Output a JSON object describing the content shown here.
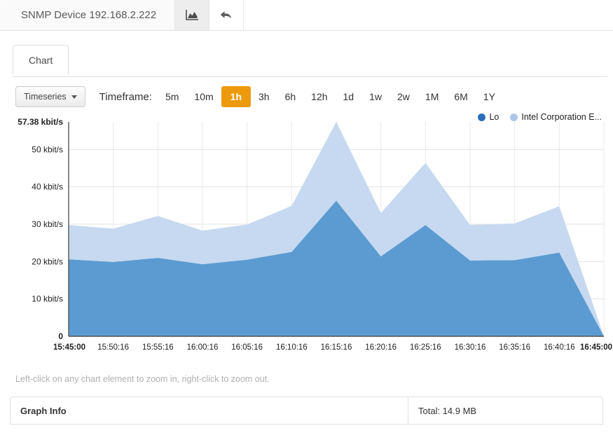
{
  "header": {
    "title": "SNMP Device 192.168.2.222",
    "chart_icon": "area-chart-icon",
    "back_icon": "back-arrow-icon"
  },
  "tabs": [
    {
      "label": "Chart",
      "active": true
    }
  ],
  "toolbar": {
    "chart_type_label": "Timeseries",
    "timeframe_label": "Timeframe:",
    "timeframes": [
      {
        "label": "5m",
        "active": false
      },
      {
        "label": "10m",
        "active": false
      },
      {
        "label": "1h",
        "active": true
      },
      {
        "label": "3h",
        "active": false
      },
      {
        "label": "6h",
        "active": false
      },
      {
        "label": "12h",
        "active": false
      },
      {
        "label": "1d",
        "active": false
      },
      {
        "label": "1w",
        "active": false
      },
      {
        "label": "2w",
        "active": false
      },
      {
        "label": "1M",
        "active": false
      },
      {
        "label": "6M",
        "active": false
      },
      {
        "label": "1Y",
        "active": false
      }
    ],
    "active_color": "#ec9a0b"
  },
  "hint": "Left-click on any chart element to zoom in, right-click to zoom out.",
  "footer": {
    "graph_info_label": "Graph Info",
    "total_label": "Total: 14.9 MB"
  },
  "chart_data": {
    "type": "area",
    "stacked": true,
    "title": "",
    "xlabel": "",
    "ylabel": "",
    "grid": true,
    "legend_position": "top-right",
    "ylim": [
      0,
      57.38
    ],
    "y_ticks": [
      {
        "value": 57.38,
        "label": "57.38 kbit/s",
        "bold": true
      },
      {
        "value": 50,
        "label": "50 kbit/s",
        "bold": false
      },
      {
        "value": 40,
        "label": "40 kbit/s",
        "bold": false
      },
      {
        "value": 30,
        "label": "30 kbit/s",
        "bold": false
      },
      {
        "value": 20,
        "label": "20 kbit/s",
        "bold": false
      },
      {
        "value": 10,
        "label": "10 kbit/s",
        "bold": false
      },
      {
        "value": 0,
        "label": "0",
        "bold": true
      }
    ],
    "categories": [
      "15:45:00",
      "15:50:16",
      "15:55:16",
      "16:00:16",
      "16:05:16",
      "16:10:16",
      "16:15:16",
      "16:20:16",
      "16:25:16",
      "16:30:16",
      "16:35:16",
      "16:40:16",
      "16:45:00"
    ],
    "x_tick_bold": [
      true,
      false,
      false,
      false,
      false,
      false,
      false,
      false,
      false,
      false,
      false,
      false,
      true
    ],
    "units": "kbit/s",
    "series": [
      {
        "name": "Lo",
        "color": "#5b9bd1",
        "values": [
          20.6,
          19.9,
          21.0,
          19.3,
          20.5,
          22.6,
          36.3,
          21.4,
          29.8,
          20.3,
          20.4,
          22.4,
          0
        ]
      },
      {
        "name": "Intel Corporation E...",
        "color": "#c6d9f0",
        "values": [
          9.2,
          8.9,
          11.2,
          9.0,
          9.4,
          12.3,
          21.1,
          11.6,
          16.6,
          9.5,
          9.8,
          12.4,
          0
        ]
      }
    ],
    "legend": [
      {
        "label": "Lo",
        "color": "#2a6ebb"
      },
      {
        "label": "Intel Corporation E...",
        "color": "#aec6e8"
      }
    ]
  }
}
